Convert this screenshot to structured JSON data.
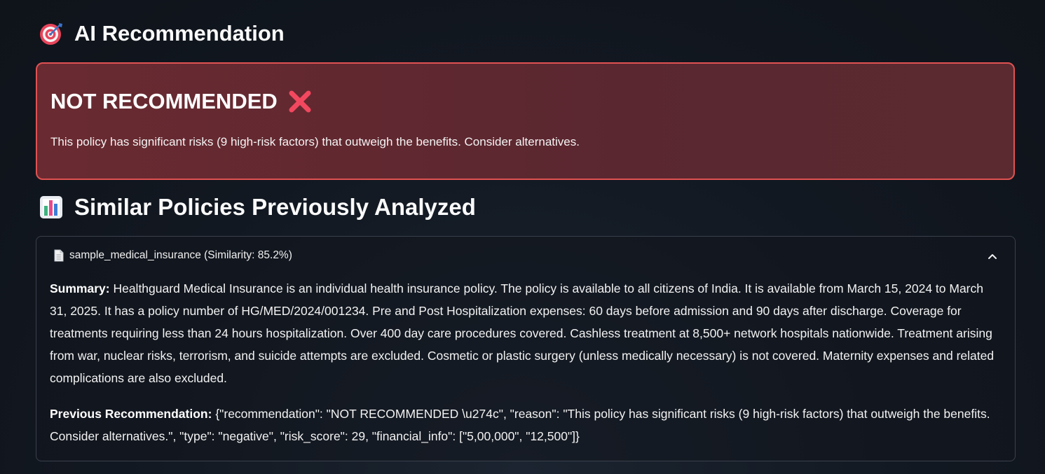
{
  "ai_section": {
    "icon": "target-dart-icon",
    "title": "AI Recommendation"
  },
  "recommendation": {
    "verdict": "NOT RECOMMENDED",
    "verdict_icon": "red-x-icon",
    "reason": "This policy has significant risks (9 high-risk factors) that outweigh the benefits. Consider alternatives.",
    "accent_color": "#e05252"
  },
  "similar_section": {
    "icon": "bar-chart-icon",
    "title": "Similar Policies Previously Analyzed"
  },
  "expander": {
    "icon": "document-icon",
    "label": "sample_medical_insurance (Similarity: 85.2%)",
    "toggle_icon": "chevron-up-icon",
    "summary_label": "Summary:",
    "summary_text": " Healthguard Medical Insurance is an individual health insurance policy. The policy is available to all citizens of India. It is available from March 15, 2024 to March 31, 2025. It has a policy number of HG/MED/2024/001234. Pre and Post Hospitalization expenses: 60 days before admission and 90 days after discharge. Coverage for treatments requiring less than 24 hours hospitalization. Over 400 day care procedures covered. Cashless treatment at 8,500+ network hospitals nationwide. Treatment arising from war, nuclear risks, terrorism, and suicide attempts are excluded. Cosmetic or plastic surgery (unless medically necessary) is not covered. Maternity expenses and related complications are also excluded.",
    "previous_label": "Previous Recommendation:",
    "previous_text": " {\"recommendation\": \"NOT RECOMMENDED \\u274c\", \"reason\": \"This policy has significant risks (9 high-risk factors) that outweigh the benefits. Consider alternatives.\", \"type\": \"negative\", \"risk_score\": 29, \"financial_info\": [\"5,00,000\", \"12,500\"]}"
  }
}
